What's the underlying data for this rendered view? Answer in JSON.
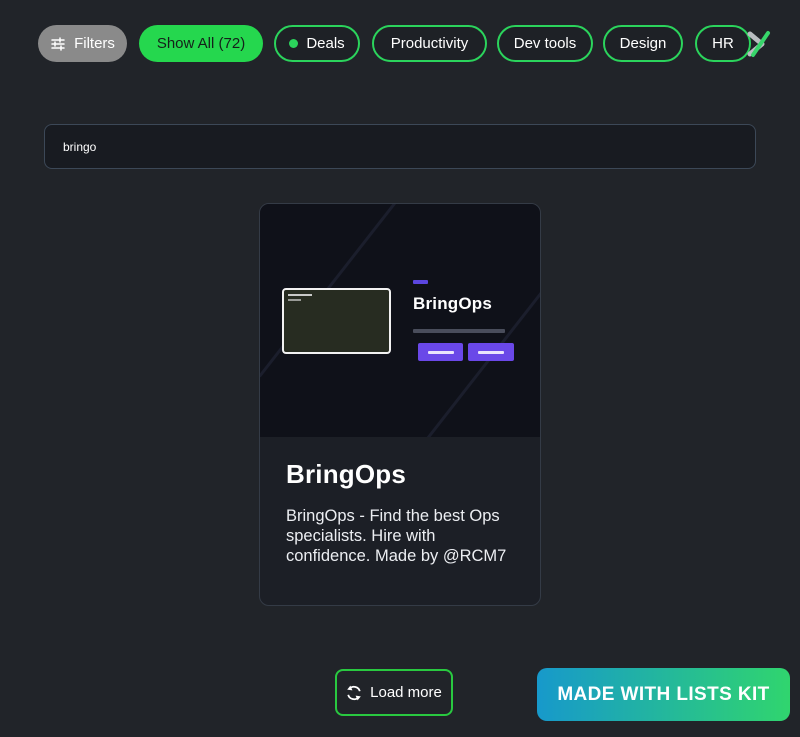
{
  "filter_bar": {
    "filters_label": "Filters",
    "show_all_label": "Show All (72)",
    "categories": [
      {
        "label": "Deals"
      },
      {
        "label": "Productivity"
      },
      {
        "label": "Dev tools"
      },
      {
        "label": "Design"
      },
      {
        "label": "HR"
      }
    ]
  },
  "search": {
    "value": "bringo"
  },
  "card": {
    "title": "BringOps",
    "description": "BringOps - Find the best Ops specialists. Hire with confidence. Made by @RCM7",
    "preview_heading": "BringOps"
  },
  "footer": {
    "load_more_label": "Load more",
    "badge_label": "MADE WITH LISTS KIT"
  },
  "icons": {
    "filters": "sliders-icon",
    "load_more": "refresh-icon",
    "scroll": "x-chevron-icon"
  },
  "colors": {
    "page_bg": "#212429",
    "accent_green": "#2bd45c",
    "show_all_bg": "#25d74e",
    "card_thumb_bg": "#0f1119",
    "purple": "#6a48e8",
    "badge_gradient_start": "#1799cb",
    "badge_gradient_end": "#30d56e"
  }
}
